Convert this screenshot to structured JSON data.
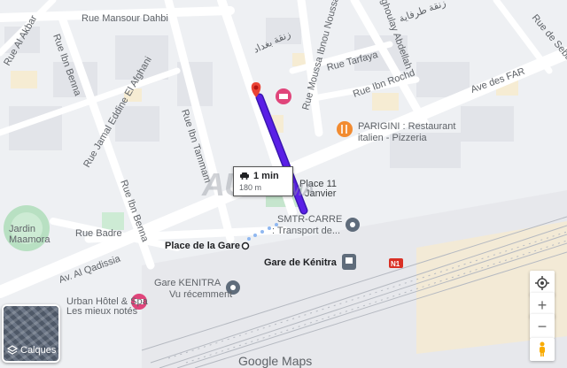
{
  "streets": {
    "rue_mansour_dahbi": "Rue Mansour Dahbi",
    "rue_al_akbar": "Rue Al Akbar",
    "rue_ibn_benna_top": "Rue Ibn Benna",
    "rue_jamal_eddine": "Rue Jamal Eddine El Afghani",
    "rue_ibn_tammam": "Rue Ibn Tammam",
    "rue_ibn_benna_bottom": "Rue Ibn Benna",
    "rue_moussa": "Rue Moussa Ibnou Noussa",
    "ghoulay_abdellah": "ghoulay Abdellah",
    "rue_tarfaya": "Rue Tarfaya",
    "rue_ibn_rochd": "Rue Ibn Rochd",
    "ave_des_far": "Ave des FAR",
    "rue_badre": "Rue Badre",
    "av_al_qadissia": "Av. Al Qadissia",
    "rue_de_seba": "Rue de Seba",
    "arabic_1": "زنقة بغداد",
    "arabic_2": "زنقة طرفاية",
    "highway_badge": "N1"
  },
  "places": {
    "jardin": "Jardin\nMaamora",
    "place_gare": "Place de la Gare",
    "gare_kenitra": "Gare de Kénitra",
    "gare_kenitra2": "Gare KENITRA",
    "vu_recemment": "Vu récemment",
    "urban_hotel": "Urban Hôtel & Spa",
    "mieux_notes": "Les mieux notés",
    "smtr_1": "SMTR-CARRE",
    "smtr_2": ": Transport de...",
    "place_11_a": "Place 11",
    "place_11_b": "Janvier",
    "parigini_1": "PARIGINI : Restaurant",
    "parigini_2": "italien - Pizzeria"
  },
  "route": {
    "duration": "1 min",
    "distance": "180 m"
  },
  "watermark": {
    "main": "AUTO",
    "suffix": "MA"
  },
  "controls": {
    "layers_label": "Calques",
    "zoom_in": "+",
    "zoom_out": "−",
    "google": "Google Maps"
  },
  "colors": {
    "route": "#5a1fe6",
    "pin": "#ea4335",
    "food": "#f28b30",
    "hotel": "#e0457b",
    "transit": "#5f6c7b",
    "park": "#b8e0c2"
  }
}
